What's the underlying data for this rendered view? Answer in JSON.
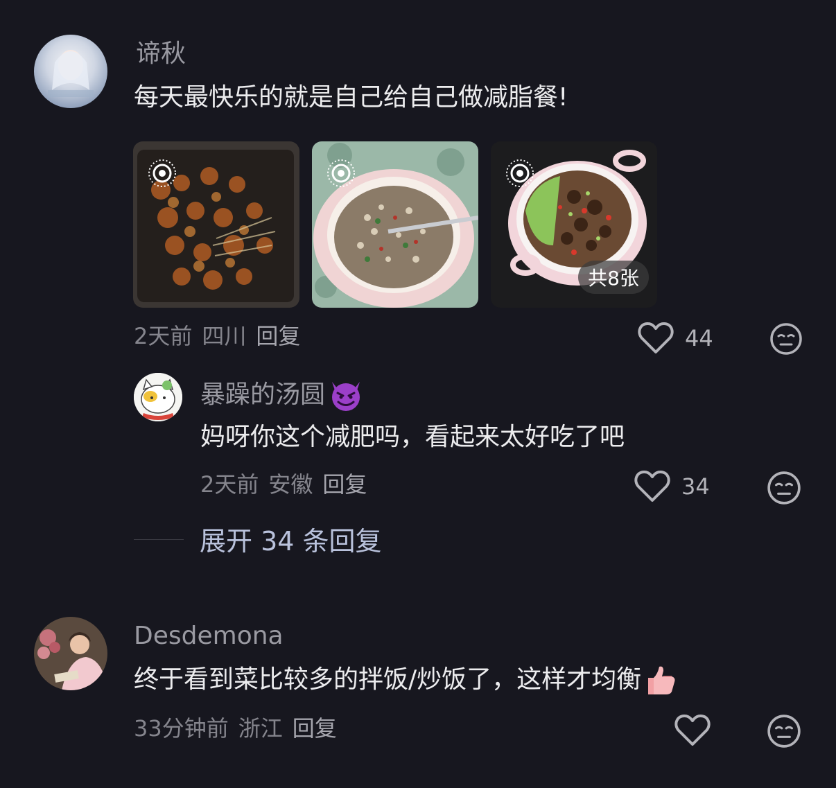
{
  "comments": [
    {
      "username": "谛秋",
      "text": "每天最快乐的就是自己给自己做减脂餐!",
      "time": "2天前",
      "location": "四川",
      "reply_label": "回复",
      "likes": "44",
      "photos_count_label": "共8张",
      "replies": [
        {
          "username": "暴躁的汤圆",
          "text": "妈呀你这个减肥吗，看起来太好吃了吧",
          "time": "2天前",
          "location": "安徽",
          "reply_label": "回复",
          "likes": "34"
        }
      ],
      "expand_label": "展开 34 条回复"
    },
    {
      "username": "Desdemona",
      "text": "终于看到菜比较多的拌饭/炒饭了，这样才均衡",
      "time": "33分钟前",
      "location": "浙江",
      "reply_label": "回复",
      "likes": ""
    }
  ],
  "icons": {
    "like": "heart-outline-icon",
    "dislike": "meh-face-icon",
    "live": "live-photo-icon",
    "emoji_devil": "smiling-devil-emoji",
    "emoji_thumb": "thumbs-up-emoji"
  },
  "colors": {
    "background": "#17171f",
    "expand_text": "#b9c2dc"
  }
}
